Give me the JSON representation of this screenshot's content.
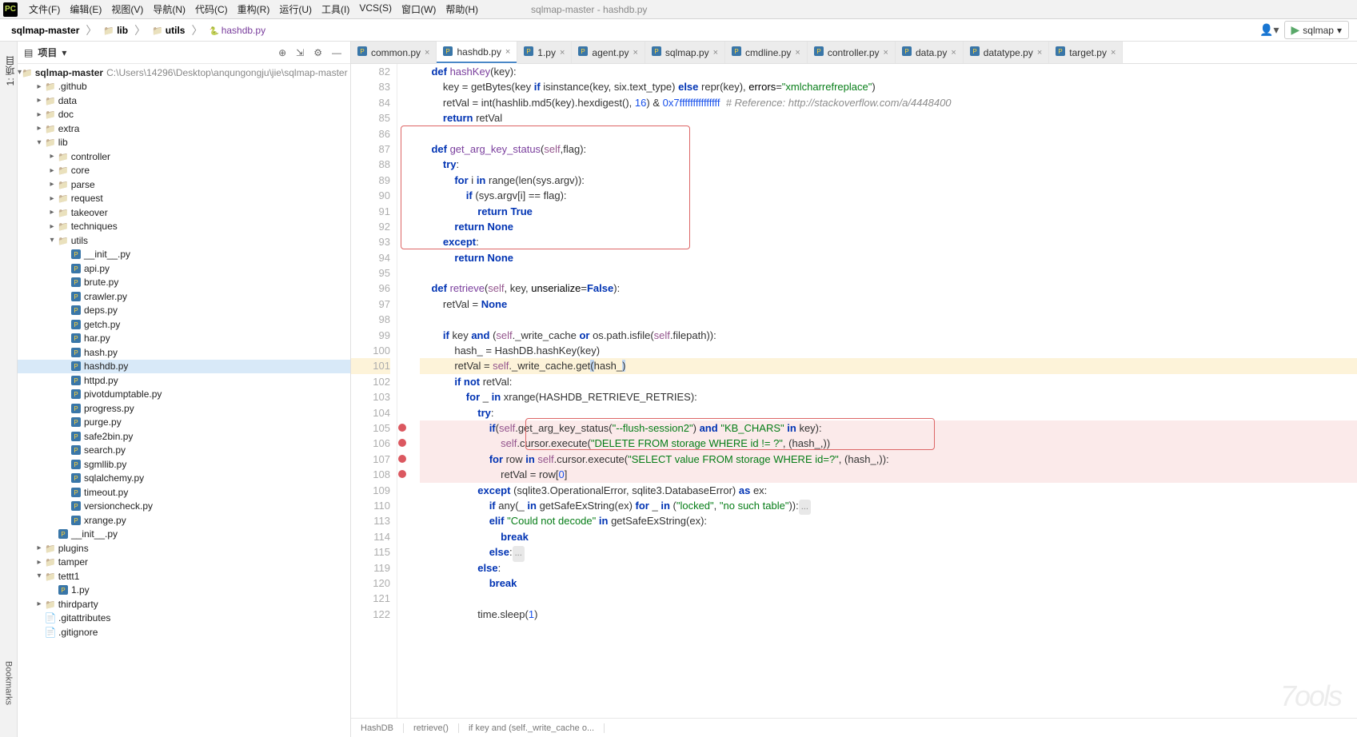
{
  "window_title": "sqlmap-master - hashdb.py",
  "menu": [
    "文件(F)",
    "编辑(E)",
    "视图(V)",
    "导航(N)",
    "代码(C)",
    "重构(R)",
    "运行(U)",
    "工具(I)",
    "VCS(S)",
    "窗口(W)",
    "帮助(H)"
  ],
  "breadcrumbs": [
    "sqlmap-master",
    "lib",
    "utils",
    "hashdb.py"
  ],
  "run_config": "sqlmap",
  "panel_title": "项目",
  "project_root_name": "sqlmap-master",
  "project_root_path": "C:\\Users\\14296\\Desktop\\anqungongju\\jie\\sqlmap-master",
  "tree": [
    {
      "d": 1,
      "t": "folder",
      "l": ".github",
      "exp": false
    },
    {
      "d": 1,
      "t": "folder",
      "l": "data",
      "exp": false
    },
    {
      "d": 1,
      "t": "folder",
      "l": "doc",
      "exp": false
    },
    {
      "d": 1,
      "t": "folder",
      "l": "extra",
      "exp": false
    },
    {
      "d": 1,
      "t": "folder",
      "l": "lib",
      "exp": true
    },
    {
      "d": 2,
      "t": "folder",
      "l": "controller",
      "exp": false
    },
    {
      "d": 2,
      "t": "folder",
      "l": "core",
      "exp": false
    },
    {
      "d": 2,
      "t": "folder",
      "l": "parse",
      "exp": false
    },
    {
      "d": 2,
      "t": "folder",
      "l": "request",
      "exp": false
    },
    {
      "d": 2,
      "t": "folder",
      "l": "takeover",
      "exp": false
    },
    {
      "d": 2,
      "t": "folder",
      "l": "techniques",
      "exp": false
    },
    {
      "d": 2,
      "t": "folder",
      "l": "utils",
      "exp": true
    },
    {
      "d": 3,
      "t": "py",
      "l": "__init__.py"
    },
    {
      "d": 3,
      "t": "py",
      "l": "api.py"
    },
    {
      "d": 3,
      "t": "py",
      "l": "brute.py"
    },
    {
      "d": 3,
      "t": "py",
      "l": "crawler.py"
    },
    {
      "d": 3,
      "t": "py",
      "l": "deps.py"
    },
    {
      "d": 3,
      "t": "py",
      "l": "getch.py"
    },
    {
      "d": 3,
      "t": "py",
      "l": "har.py"
    },
    {
      "d": 3,
      "t": "py",
      "l": "hash.py"
    },
    {
      "d": 3,
      "t": "py",
      "l": "hashdb.py",
      "sel": true
    },
    {
      "d": 3,
      "t": "py",
      "l": "httpd.py"
    },
    {
      "d": 3,
      "t": "py",
      "l": "pivotdumptable.py"
    },
    {
      "d": 3,
      "t": "py",
      "l": "progress.py"
    },
    {
      "d": 3,
      "t": "py",
      "l": "purge.py"
    },
    {
      "d": 3,
      "t": "py",
      "l": "safe2bin.py"
    },
    {
      "d": 3,
      "t": "py",
      "l": "search.py"
    },
    {
      "d": 3,
      "t": "py",
      "l": "sgmllib.py"
    },
    {
      "d": 3,
      "t": "py",
      "l": "sqlalchemy.py"
    },
    {
      "d": 3,
      "t": "py",
      "l": "timeout.py"
    },
    {
      "d": 3,
      "t": "py",
      "l": "versioncheck.py"
    },
    {
      "d": 3,
      "t": "py",
      "l": "xrange.py"
    },
    {
      "d": 2,
      "t": "py",
      "l": "__init__.py"
    },
    {
      "d": 1,
      "t": "folder",
      "l": "plugins",
      "exp": false
    },
    {
      "d": 1,
      "t": "folder",
      "l": "tamper",
      "exp": false
    },
    {
      "d": 1,
      "t": "folder",
      "l": "tettt1",
      "exp": true
    },
    {
      "d": 2,
      "t": "py",
      "l": "1.py"
    },
    {
      "d": 1,
      "t": "folder",
      "l": "thirdparty",
      "exp": false
    },
    {
      "d": 1,
      "t": "file",
      "l": ".gitattributes"
    },
    {
      "d": 1,
      "t": "file",
      "l": ".gitignore"
    }
  ],
  "tabs": [
    {
      "label": "common.py"
    },
    {
      "label": "hashdb.py",
      "active": true
    },
    {
      "label": "1.py"
    },
    {
      "label": "agent.py"
    },
    {
      "label": "sqlmap.py"
    },
    {
      "label": "cmdline.py"
    },
    {
      "label": "controller.py"
    },
    {
      "label": "data.py"
    },
    {
      "label": "datatype.py"
    },
    {
      "label": "target.py"
    }
  ],
  "code": {
    "line_numbers": [
      "82",
      "83",
      "84",
      "85",
      "86",
      "87",
      "88",
      "89",
      "90",
      "91",
      "92",
      "93",
      "94",
      "95",
      "96",
      "97",
      "98",
      "99",
      "100",
      "101",
      "102",
      "103",
      "104",
      "105",
      "106",
      "107",
      "108",
      "109",
      "110",
      "113",
      "114",
      "115",
      "119",
      "120",
      "121",
      "122"
    ],
    "highlight_line_idx": 19,
    "breakpoint_idx": [
      23,
      24,
      25,
      26
    ],
    "error_idx": [
      23,
      24,
      25,
      26
    ]
  },
  "footer_crumbs": [
    "HashDB",
    "retrieve()",
    "if key and (self._write_cache o..."
  ],
  "watermark": "7ools",
  "sidebar_label": "Bookmarks",
  "panel_proj_label": "1: 项目"
}
